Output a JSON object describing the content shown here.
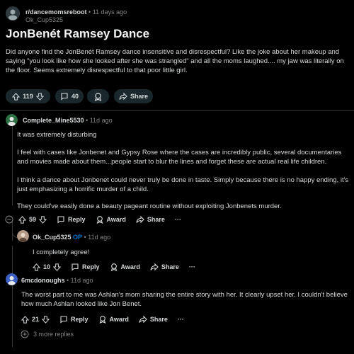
{
  "post": {
    "subreddit": "r/dancemomsreboot",
    "separator": "•",
    "age": "11 days ago",
    "author": "Ok_Cup5325",
    "title": "JonBenét Ramsey Dance",
    "body": "Did anyone find the JonBenét Ramsey dance insensitive and disrespectful? Like the joke about her makeup and saying \"you look like how she looked after she was strangled\" and all the moms laughed.... my jaw was literally on the floor. Seems extremely disrespectful to that poor little girl.",
    "votes": "119",
    "comments": "40",
    "share_label": "Share"
  },
  "comments": [
    {
      "user": "Complete_Mine5530",
      "age": "• 11d ago",
      "paragraphs": [
        "It was extremely disturbing",
        "I feel with cases like Jonbenet and Gypsy Rose where the cases are incredibly public, several documentaries and movies made about them...people start to blur the lines and forget these are actual real life children.",
        "I think a dance about Jonbenet could never truly be done in taste. Simply because there is no happy ending, it's just emphasizing a horrific murder of a child.",
        "They could've easily done a beauty pageant routine without exploiting Jonbenets murder."
      ],
      "votes": "59"
    },
    {
      "user": "Ok_Cup5325",
      "op_badge": "OP",
      "age": "• 11d ago",
      "text": "I completely agree!",
      "votes": "10"
    },
    {
      "user": "6mcdonoughs",
      "age": "• 11d ago",
      "text": "The worst part to me was Ashlan's mom sharing the entire story with her. It clearly upset her. I couldn't believe how much Ashlan looked like Jon Benet.",
      "votes": "21"
    }
  ],
  "actions": {
    "reply": "Reply",
    "award": "Award",
    "share": "Share",
    "more": "···"
  },
  "more_replies": "3 more replies",
  "colors": {
    "background": "#000000",
    "pill": "#1a282d",
    "op_badge": "#0079d3",
    "muted": "#818384",
    "text": "#d7dadc"
  }
}
